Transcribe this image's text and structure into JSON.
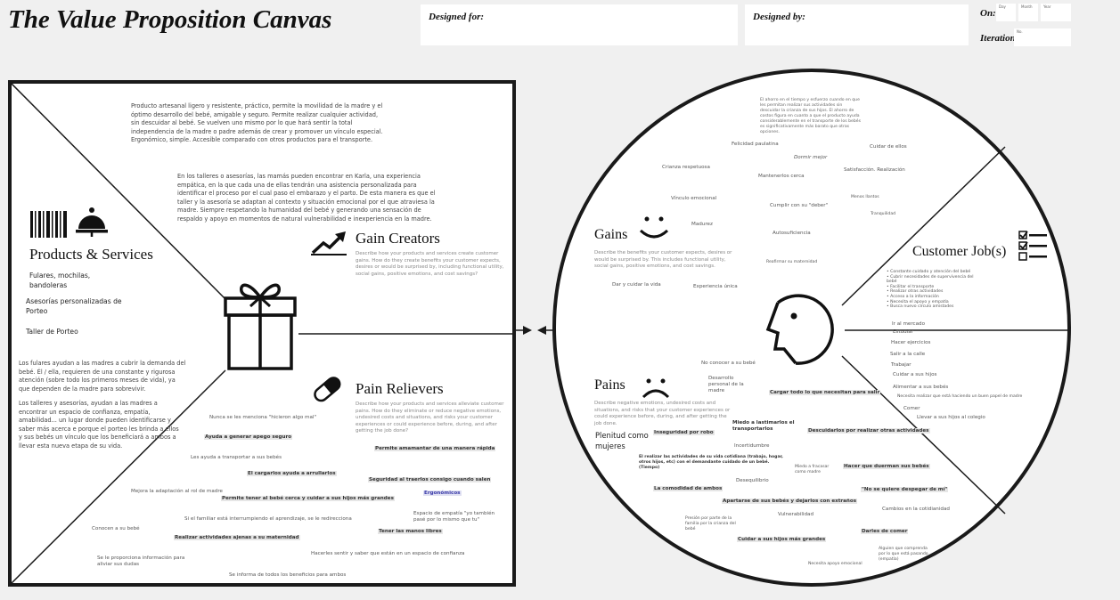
{
  "header": {
    "title": "The Value Proposition Canvas",
    "designed_for_label": "Designed for:",
    "designed_by_label": "Designed by:",
    "on_label": "On:",
    "day_label": "Day",
    "month_label": "Month",
    "year_label": "Year",
    "iteration_label": "Iteration:",
    "iteration_no_label": "No."
  },
  "value_map": {
    "products_services": {
      "title": "Products & Services",
      "items": [
        "Fulares, mochilas, bandoleras",
        "Asesorías personalizadas de Porteo",
        "Taller de Porteo"
      ],
      "note": "Los fulares ayudan a las madres a cubrir la demanda del bebé. Él / ella, requieren de una constante y rigurosa atención (sobre todo los primeros meses de vida), ya que dependen de la madre para sobrevivir.",
      "note2": "Los talleres y asesorías, ayudan a las madres a encontrar un espacio de confianza, empatía, amabilidad... un lugar donde pueden identificarse y saber más acerca e porque el porteo les brinda a ellos y sus bebés un vínculo que los beneficiará a ambos a llevar esta nueva etapa de su vida."
    },
    "gain_creators": {
      "title": "Gain Creators",
      "description": "Describe how your products and services create customer gains. How do they create benefits your customer expects, desires or would be surprised by, including functional utility, social gains, positive emotions, and cost savings?",
      "text1": "Producto artesanal ligero y resistente, práctico, permite la movilidad de la madre y el óptimo desarrollo del bebé, amigable y seguro. Permite realizar cualquier actividad, sin descuidar al bebé.  Se vuelven uno mismo por lo que hará sentir la total independencia de la madre o padre además de crear y promover un vínculo especial. Ergonómico, simple. Accesible comparado con otros productos para el transporte.",
      "text2": "En los talleres o asesorías, las mamás pueden encontrar en Karla, una experiencia empática, en la que cada una de ellas tendrán una asistencia personalizada para identificar el proceso por el cual paso el embarazo y el parto. De esta manera es que el taller y la asesoría se adaptan al contexto y situación emocional por el que atraviesa la madre. Siempre respetando la humanidad del bebé y generando una sensación de respaldo y apoyo en momentos de natural vulnerabilidad e inexperiencia en la madre."
    },
    "pain_relievers": {
      "title": "Pain Relievers",
      "description": "Describe how your products and services alleviate customer pains. How do they eliminate or reduce negative emotions, undesired costs and situations, and risks your customer experiences or could experience before, during, and after getting the job done?",
      "notes": [
        "Nunca se les menciona \"hicieron algo mal\"",
        "Ayuda a generar apego seguro",
        "Permite amamantar de una manera rápida",
        "Les ayuda a transportar a sus bebés",
        "El cargarlos ayuda a arrullarlos",
        "Seguridad al traerlos consigo cuando salen",
        "Mejora la adaptación al rol de madre",
        "Permite tener al bebé cerca y cuidar a sus hijos más grandes",
        "Ergonómicos",
        "Si el familiar está interrumpiendo el aprendizaje, se le redirecciona",
        "Espacio de empatía \"yo también pasé por lo mismo que tu\"",
        "Conocen a su bebé",
        "Realizar actividades ajenas a su maternidad",
        "Tener las manos libres",
        "Se le proporciona información para aliviar sus dudas",
        "Hacerles sentir y saber que están en un espacio de confianza",
        "Se informa de todos los beneficios para ambos"
      ]
    }
  },
  "customer_profile": {
    "gains": {
      "title": "Gains",
      "description": "Describe the benefits your customer expects, desires or would be surprised by. This includes functional utility, social gains, positive emotions, and cost savings.",
      "top_note": "El ahorro en el tiempo y esfuerzo cuando en que les permitan realizar sus actividades sin descuidar la crianza de sus hijos. El ahorro de costos figura en cuanto a que el producto ayuda considerablemente en el transporte de los bebés es significativamente más barato que otras opciones.",
      "notes": [
        "Felicidad paulatina",
        "Dormir mejor",
        "Cuidar de ellos",
        "Crianza respetuosa",
        "Satisfacción. Realización",
        "Mantenerlos cerca",
        "Menos llantos",
        "Vínculo emocional",
        "Cumplir con su \"deber\"",
        "Tranquilidad",
        "Madurez",
        "Autosuficiencia",
        "Reafirmar su maternidad",
        "Dar y cuidar la vida",
        "Experiencia única"
      ]
    },
    "customer_jobs": {
      "title": "Customer Job(s)",
      "bullets": [
        "Constante cuidado y atención del bebé",
        "Cubrir necesidades de supervivencia del bebé",
        "Facilitar el transporte",
        "Realizar otras actividades",
        "Acceso a la información",
        "Necesita el apoyo y empatía",
        "Busca nuevo círculo amistades"
      ],
      "notes": [
        "Ir al mercado",
        "Estudiar",
        "Hacer ejercicios",
        "Salir a la calle",
        "Trabajar",
        "Cuidar a sus hijos",
        "Alimentar a sus bebés",
        "Necesita realizar que está haciendo un buen papel de madre",
        "Comer",
        "Llevar a sus hijos al colegio"
      ]
    },
    "pains": {
      "title": "Pains",
      "description": "Describe negative emotions, undesired costs and situations, and risks that your customer experiences or could experience before, during, and after getting the job done.",
      "notes": [
        "No conocer a su bebé",
        "Desarrollo personal de la madre",
        "Cargar todo lo que necesitan para salir",
        "Plenitud como mujeres",
        "Inseguridad por robo",
        "Miedo a lastimarlos el transportarlos",
        "Descuidarlos por realizar otras actividades",
        "Incertidumbre",
        "El realizar las actividades de su vida cotidiana (trabajo, hogar, otros hijos, etc) con el demandante cuidado de un bebé. (Tiempo)",
        "Miedo a fracasar como madre",
        "Hacer que duerman sus bebés",
        "Desequilibrio",
        "La comodidad de ambos",
        "\"No se quiere despegar de mí\"",
        "Apartarse de sus bebés y dejarlos con extraños",
        "Cambios en la cotidianidad",
        "Vulnerabilidad",
        "Presión por parte de la familia por la crianza del bebé",
        "Darles de comer",
        "Cuidar a sus hijos más grandes",
        "Alguien que comprenda por lo que está pasando (empatía)",
        "Necesita apoyo emocional"
      ]
    }
  }
}
